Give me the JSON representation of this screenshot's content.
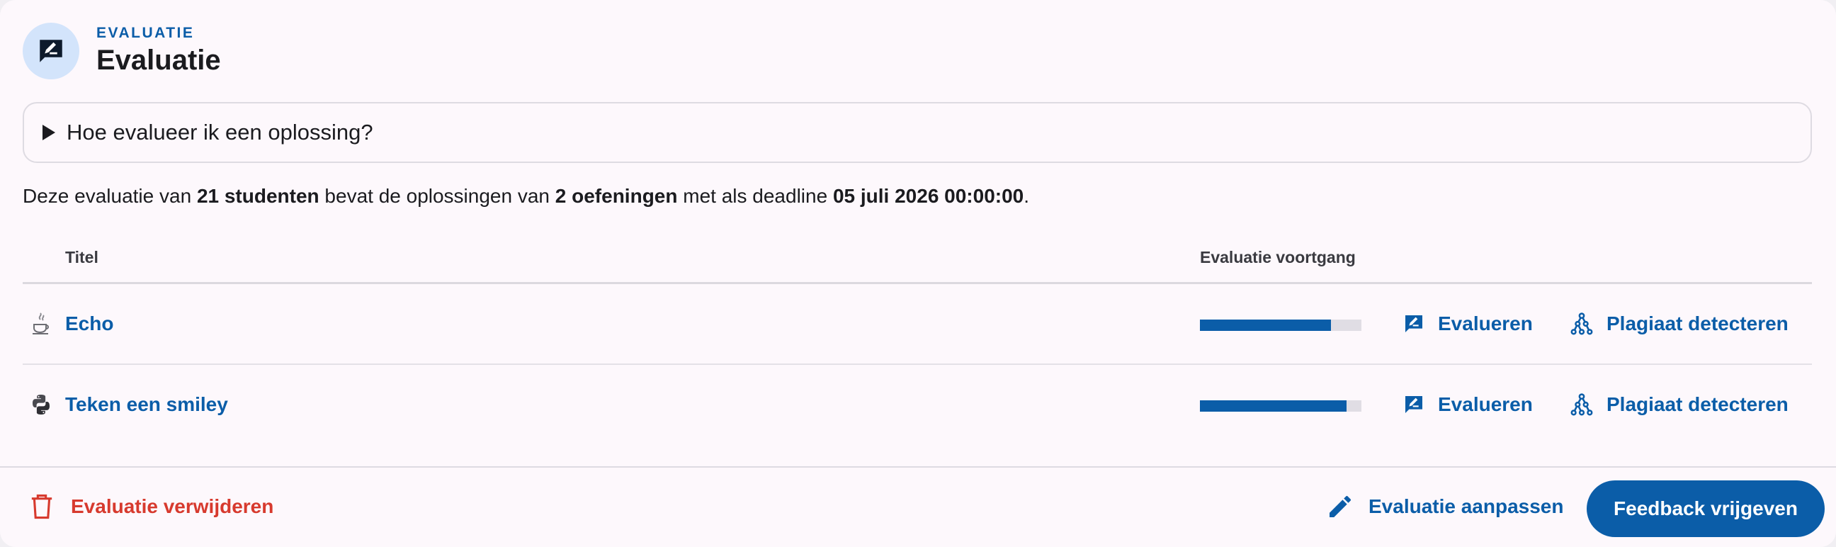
{
  "header": {
    "overline": "EVALUATIE",
    "title": "Evaluatie",
    "icon": "rate-review-icon"
  },
  "help": {
    "label": "Hoe evalueer ik een oplossing?"
  },
  "summary": {
    "part1": "Deze evaluatie van ",
    "students": "21 studenten",
    "part2": " bevat de oplossingen van ",
    "exercises": "2 oefeningen",
    "part3": " met als deadline ",
    "deadline": "05 juli 2026 00:00:00",
    "part4": "."
  },
  "table": {
    "headers": {
      "title": "Titel",
      "progress": "Evaluatie voortgang"
    },
    "rows": [
      {
        "title": "Echo",
        "language_icon": "java-icon",
        "progress": 0.81
      },
      {
        "title": "Teken een smiley",
        "language_icon": "python-icon",
        "progress": 0.91
      }
    ],
    "actions": {
      "evaluate": "Evalueren",
      "plagiarism": "Plagiaat detecteren"
    }
  },
  "footer": {
    "delete": "Evaluatie verwijderen",
    "edit": "Evaluatie aanpassen",
    "release": "Feedback vrijgeven"
  },
  "colors": {
    "primary": "#0b5da8",
    "danger": "#d73a2e",
    "avatar_bg": "#d3e4fb"
  }
}
